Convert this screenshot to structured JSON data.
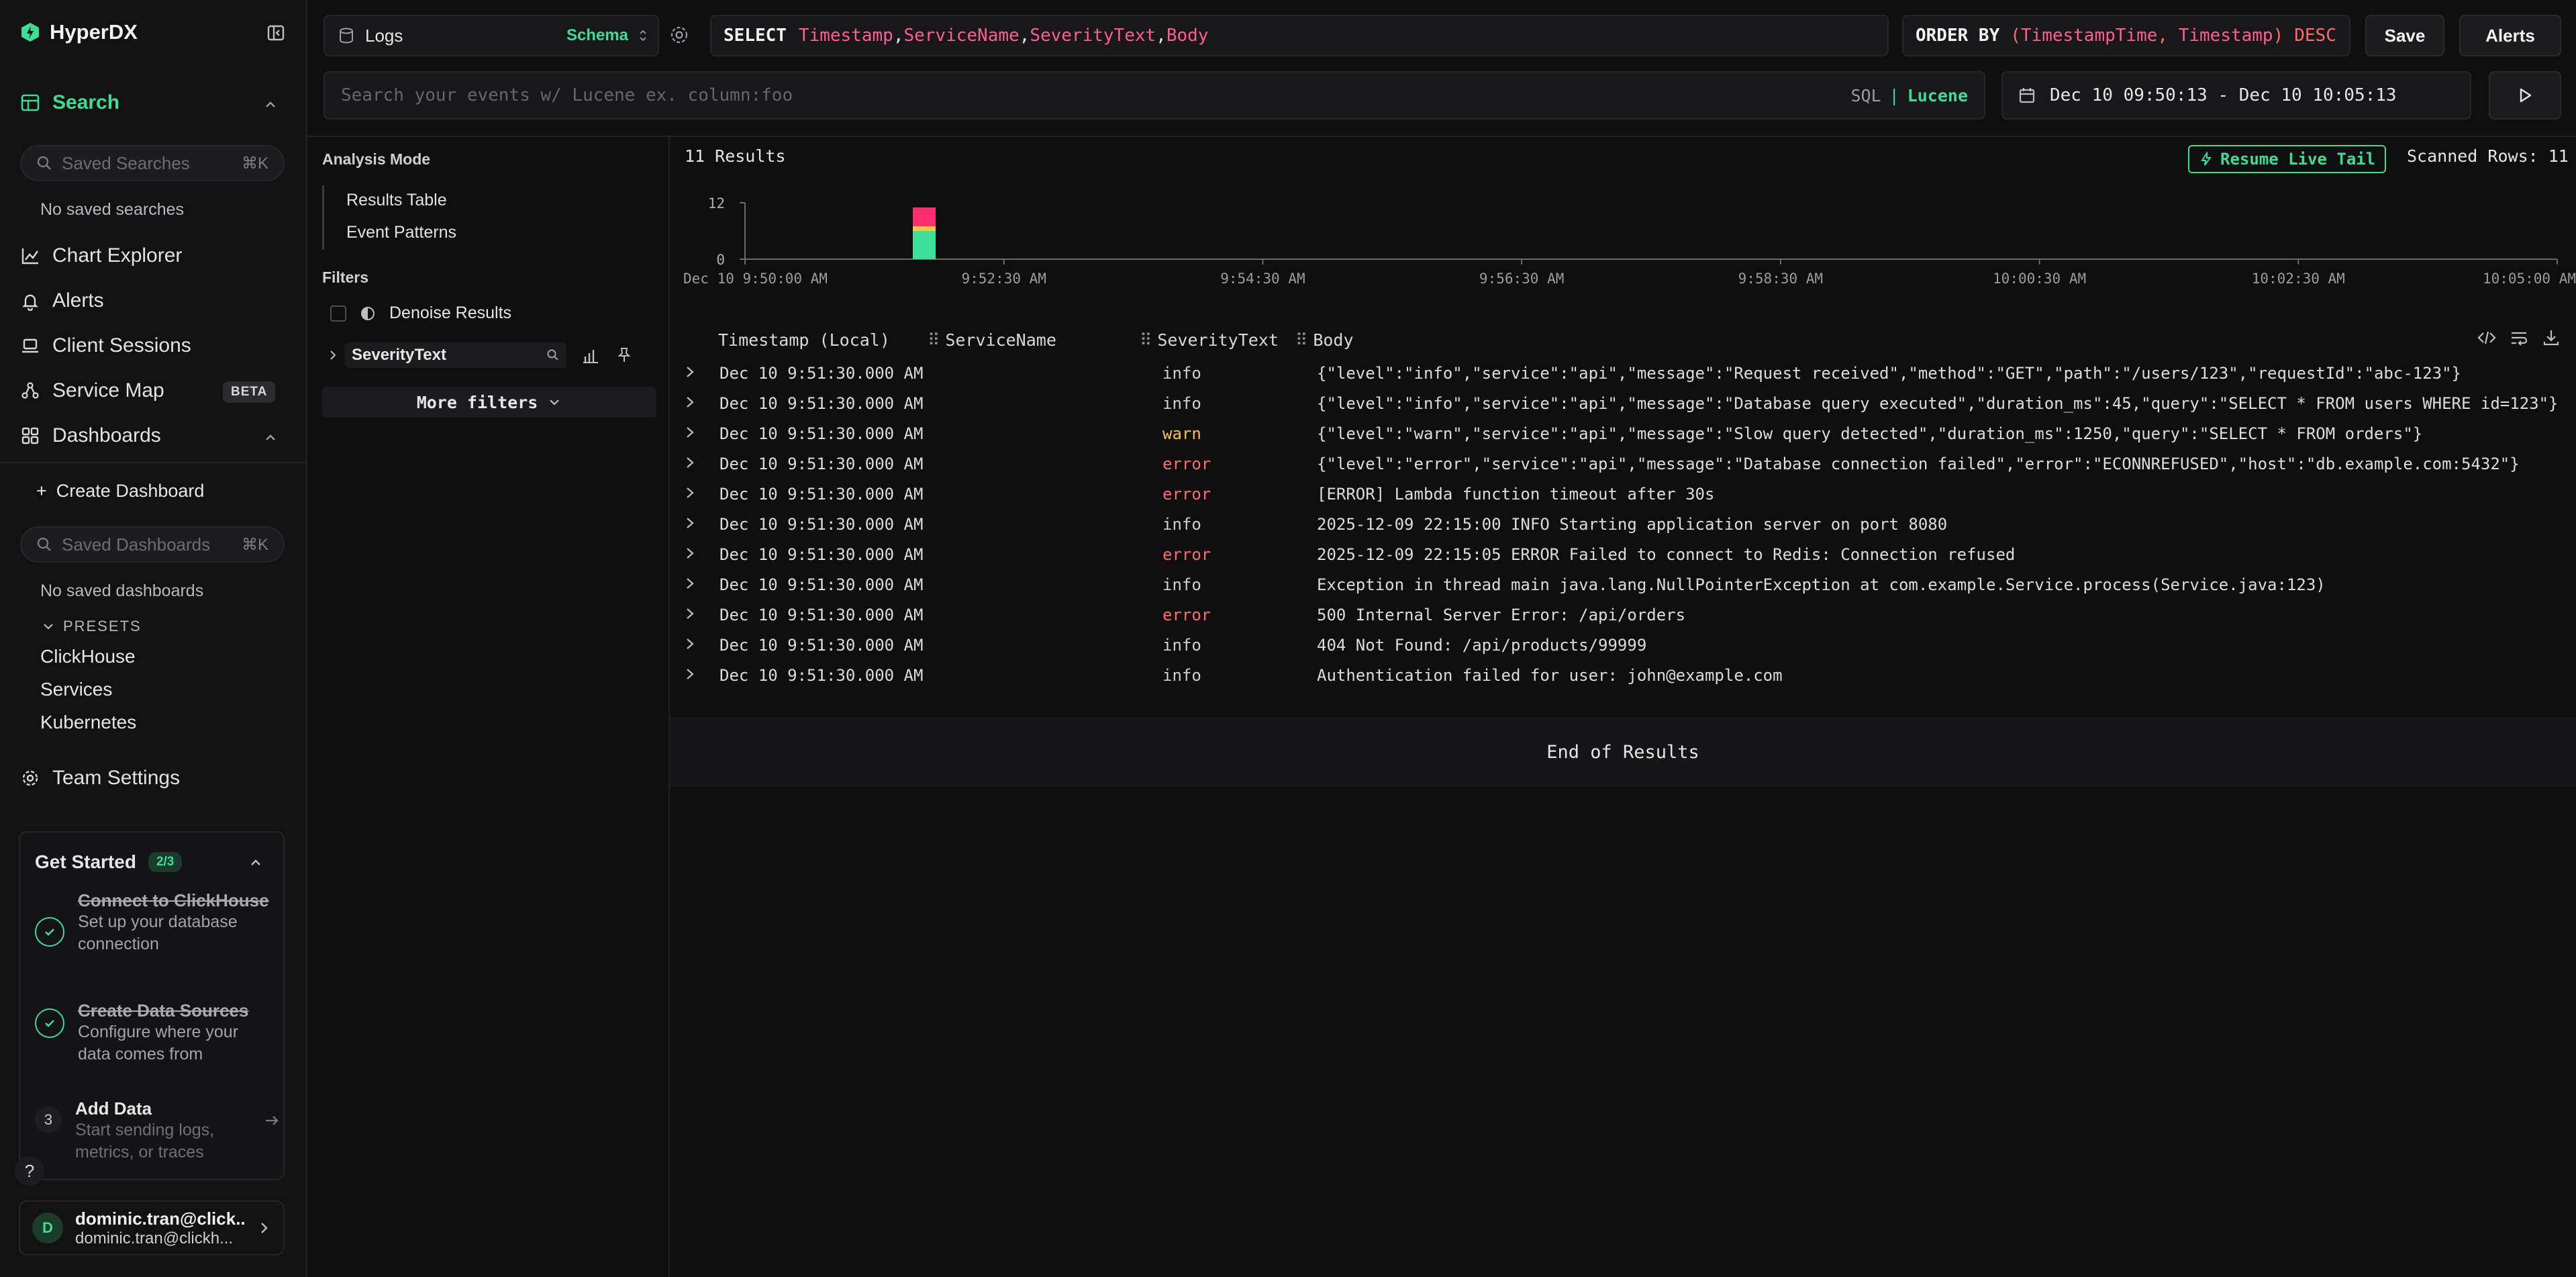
{
  "app": {
    "name": "HyperDX"
  },
  "sidebar": {
    "search_label": "Search",
    "saved_searches_placeholder": "Saved Searches",
    "saved_searches_kbd": "⌘K",
    "no_saved_searches": "No saved searches",
    "nav": {
      "chart_explorer": "Chart Explorer",
      "alerts": "Alerts",
      "client_sessions": "Client Sessions",
      "service_map": "Service Map",
      "service_map_badge": "BETA",
      "dashboards": "Dashboards"
    },
    "create_dashboard": "Create Dashboard",
    "saved_dashboards_placeholder": "Saved Dashboards",
    "saved_dashboards_kbd": "⌘K",
    "no_saved_dashboards": "No saved dashboards",
    "presets_label": "PRESETS",
    "presets": [
      "ClickHouse",
      "Services",
      "Kubernetes"
    ],
    "team_settings": "Team Settings",
    "get_started": {
      "title": "Get Started",
      "count": "2/3",
      "steps": [
        {
          "title": "Connect to ClickHouse",
          "desc": "Set up your database connection",
          "done": true
        },
        {
          "title": "Create Data Sources",
          "desc": "Configure where your data comes from",
          "done": true
        },
        {
          "num": "3",
          "title": "Add Data",
          "desc": "Start sending logs, metrics, or traces",
          "done": false
        }
      ]
    },
    "help": "?",
    "user": {
      "initial": "D",
      "name": "dominic.tran@click...",
      "email": "dominic.tran@clickh..."
    }
  },
  "topbar": {
    "source": "Logs",
    "schema_label": "Schema",
    "select_keyword": "SELECT",
    "select_columns": [
      "Timestamp",
      "ServiceName",
      "SeverityText",
      "Body"
    ],
    "order_by_keyword": "ORDER BY",
    "order_by_expr": [
      "TimestampTime",
      "Timestamp"
    ],
    "order_dir": "DESC",
    "save": "Save",
    "alerts": "Alerts",
    "search_placeholder": "Search your events w/ Lucene ex. column:foo",
    "lang_sql": "SQL",
    "lang_sep": "|",
    "lang_lucene": "Lucene",
    "time_range": "Dec 10 09:50:13 - Dec 10 10:05:13"
  },
  "leftpanel": {
    "analysis_mode": "Analysis Mode",
    "modes": [
      "Results Table",
      "Event Patterns"
    ],
    "filters": "Filters",
    "denoise": "Denoise Results",
    "severity_field": "SeverityText",
    "more_filters": "More filters"
  },
  "results": {
    "count": "11 Results",
    "resume_live_tail": "Resume Live Tail",
    "scanned_rows": "Scanned Rows: 11",
    "end_of_results": "End of Results",
    "columns": [
      "Timestamp (Local)",
      "ServiceName",
      "SeverityText",
      "Body"
    ],
    "rows": [
      {
        "ts": "Dec 10 9:51:30.000 AM",
        "service": "",
        "sev": "info",
        "body": "{\"level\":\"info\",\"service\":\"api\",\"message\":\"Request received\",\"method\":\"GET\",\"path\":\"/users/123\",\"requestId\":\"abc-123\"}"
      },
      {
        "ts": "Dec 10 9:51:30.000 AM",
        "service": "",
        "sev": "info",
        "body": "{\"level\":\"info\",\"service\":\"api\",\"message\":\"Database query executed\",\"duration_ms\":45,\"query\":\"SELECT * FROM users WHERE id=123\"}"
      },
      {
        "ts": "Dec 10 9:51:30.000 AM",
        "service": "",
        "sev": "warn",
        "body": "{\"level\":\"warn\",\"service\":\"api\",\"message\":\"Slow query detected\",\"duration_ms\":1250,\"query\":\"SELECT * FROM orders\"}"
      },
      {
        "ts": "Dec 10 9:51:30.000 AM",
        "service": "",
        "sev": "error",
        "body": "{\"level\":\"error\",\"service\":\"api\",\"message\":\"Database connection failed\",\"error\":\"ECONNREFUSED\",\"host\":\"db.example.com:5432\"}"
      },
      {
        "ts": "Dec 10 9:51:30.000 AM",
        "service": "",
        "sev": "error",
        "body": "[ERROR] Lambda function timeout after 30s"
      },
      {
        "ts": "Dec 10 9:51:30.000 AM",
        "service": "",
        "sev": "info",
        "body": "2025-12-09 22:15:00 INFO Starting application server on port 8080"
      },
      {
        "ts": "Dec 10 9:51:30.000 AM",
        "service": "",
        "sev": "error",
        "body": "2025-12-09 22:15:05 ERROR Failed to connect to Redis: Connection refused"
      },
      {
        "ts": "Dec 10 9:51:30.000 AM",
        "service": "",
        "sev": "info",
        "body": "Exception in thread main java.lang.NullPointerException at com.example.Service.process(Service.java:123)"
      },
      {
        "ts": "Dec 10 9:51:30.000 AM",
        "service": "",
        "sev": "error",
        "body": "500 Internal Server Error: /api/orders"
      },
      {
        "ts": "Dec 10 9:51:30.000 AM",
        "service": "",
        "sev": "info",
        "body": "404 Not Found: /api/products/99999"
      },
      {
        "ts": "Dec 10 9:51:30.000 AM",
        "service": "",
        "sev": "info",
        "body": "Authentication failed for user: john@example.com"
      }
    ]
  },
  "chart_data": {
    "type": "bar",
    "stacked": true,
    "ylim": [
      0,
      12
    ],
    "y_ticks": [
      "0",
      "12"
    ],
    "x_ticks": [
      "Dec 10 9:50:00 AM",
      "9:52:30 AM",
      "9:54:30 AM",
      "9:56:30 AM",
      "9:58:30 AM",
      "10:00:30 AM",
      "10:02:30 AM",
      "10:05:00 AM"
    ],
    "bucket": "9:51:30 AM",
    "series": [
      {
        "severity": "info",
        "color": "#3ddc97",
        "value": 6
      },
      {
        "severity": "warn",
        "color": "#f5c542",
        "value": 1
      },
      {
        "severity": "error",
        "color": "#ff2d6f",
        "value": 4
      }
    ]
  },
  "colors": {
    "accent": "#3ddc97",
    "error": "#ff6b6b",
    "warn": "#f5c542",
    "pink": "#ff5d8f"
  }
}
